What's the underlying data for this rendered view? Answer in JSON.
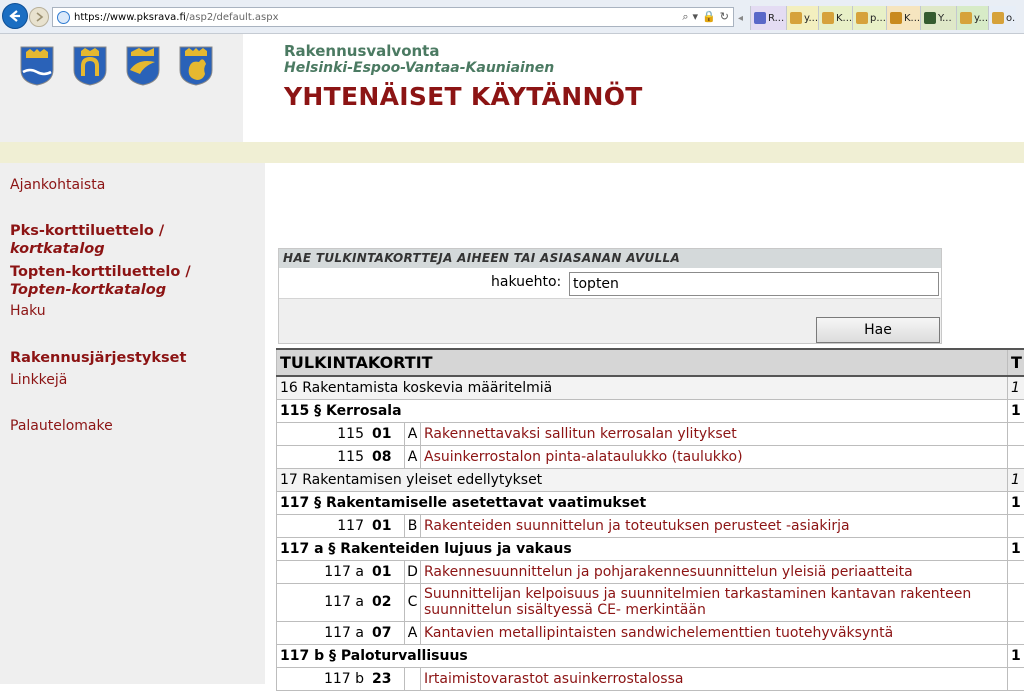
{
  "browser": {
    "url_host": "https://www.pksrava.fi",
    "url_path": "/asp2/default.aspx",
    "tabs": [
      "R...",
      "y...",
      "K...",
      "p...",
      "K...",
      "Y...",
      "y...",
      "o..."
    ]
  },
  "header": {
    "org": "Rakennusvalvonta",
    "cities": "Helsinki-Espoo-Vantaa-Kauniainen",
    "title": "YHTENÄISET KÄYTÄNNÖT"
  },
  "sidebar": {
    "ajankohtaista": "Ajankohtaista",
    "pks_1": "Pks-korttiluettelo /",
    "pks_2": "kortkatalog",
    "topten_1": "Topten-korttiluettelo /",
    "topten_2": "Topten-kortkatalog",
    "haku": "Haku",
    "rakennus": "Rakennusjärjestykset",
    "linkit": "Linkkejä",
    "palaute": "Palautelomake"
  },
  "search": {
    "heading": "HAE TULKINTAKORTTEJA AIHEEN TAI ASIASANAN AVULLA",
    "label": "hakuehto:",
    "value": "topten",
    "button": "Hae"
  },
  "table": {
    "header": "TULKINTAKORTIT",
    "header_right": "T",
    "rows": [
      {
        "kind": "chapter",
        "text": "16 Rakentamista koskevia määritelmiä",
        "right": "1"
      },
      {
        "kind": "section",
        "text": "115 § Kerrosala",
        "right": "1"
      },
      {
        "kind": "card",
        "sec": "115",
        "no": "01",
        "cls": "A",
        "title": "Rakennettavaksi sallitun kerrosalan ylitykset"
      },
      {
        "kind": "card",
        "sec": "115",
        "no": "08",
        "cls": "A",
        "title": "Asuinkerrostalon pinta-alataulukko (taulukko)"
      },
      {
        "kind": "chapter",
        "text": "17 Rakentamisen yleiset edellytykset",
        "right": "1"
      },
      {
        "kind": "section",
        "text": "117 § Rakentamiselle asetettavat vaatimukset",
        "right": "1"
      },
      {
        "kind": "card",
        "sec": "117",
        "no": "01",
        "cls": "B",
        "title": "Rakenteiden suunnittelun ja toteutuksen perusteet -asiakirja"
      },
      {
        "kind": "section",
        "text": "117 a § Rakenteiden lujuus ja vakaus",
        "right": "1"
      },
      {
        "kind": "card",
        "sec": "117 a",
        "no": "01",
        "cls": "D",
        "title": "Rakennesuunnittelun ja pohjarakennesuunnittelun yleisiä periaatteita"
      },
      {
        "kind": "card",
        "sec": "117 a",
        "no": "02",
        "cls": "C",
        "title": "Suunnittelijan kelpoisuus ja suunnitelmien tarkastaminen kantavan rakenteen suunnittelun sisältyessä CE- merkintään"
      },
      {
        "kind": "card",
        "sec": "117 a",
        "no": "07",
        "cls": "A",
        "title": "Kantavien metallipintaisten sandwichelementtien tuotehyväksyntä"
      },
      {
        "kind": "section",
        "text": "117 b § Paloturvallisuus",
        "right": "1"
      },
      {
        "kind": "card",
        "sec": "117 b",
        "no": "23",
        "cls": "",
        "title": "Irtaimistovarastot asuinkerrostalossa"
      }
    ]
  }
}
